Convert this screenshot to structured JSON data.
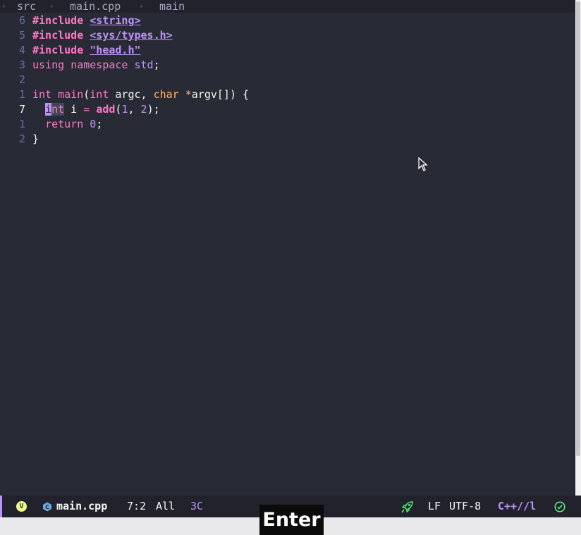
{
  "breadcrumb": {
    "sep": "›",
    "items": [
      "src",
      "main.cpp",
      "main"
    ]
  },
  "lines": [
    {
      "ln": "6",
      "parts": [
        {
          "t": "#include",
          "c": "kw-b"
        },
        {
          "t": " ",
          "c": ""
        },
        {
          "t": "<string>",
          "c": "inc"
        }
      ]
    },
    {
      "ln": "5",
      "parts": [
        {
          "t": "#include",
          "c": "kw-b"
        },
        {
          "t": " ",
          "c": ""
        },
        {
          "t": "<sys/types.h>",
          "c": "inc"
        }
      ]
    },
    {
      "ln": "4",
      "parts": [
        {
          "t": "#include",
          "c": "kw-b"
        },
        {
          "t": " ",
          "c": ""
        },
        {
          "t": "\"head.h\"",
          "c": "inc"
        }
      ]
    },
    {
      "ln": "3",
      "parts": [
        {
          "t": "using",
          "c": "kw"
        },
        {
          "t": " ",
          "c": ""
        },
        {
          "t": "namespace",
          "c": "kw"
        },
        {
          "t": " ",
          "c": ""
        },
        {
          "t": "std",
          "c": "std"
        },
        {
          "t": ";",
          "c": ""
        }
      ]
    },
    {
      "ln": "2",
      "parts": []
    },
    {
      "ln": "1",
      "parts": [
        {
          "t": "int",
          "c": "kw"
        },
        {
          "t": " ",
          "c": ""
        },
        {
          "t": "main",
          "c": "kw"
        },
        {
          "t": "(",
          "c": ""
        },
        {
          "t": "int",
          "c": "kw"
        },
        {
          "t": " argc, ",
          "c": ""
        },
        {
          "t": "char",
          "c": "char"
        },
        {
          "t": " ",
          "c": ""
        },
        {
          "t": "*",
          "c": "ptr"
        },
        {
          "t": "argv[]) {",
          "c": ""
        }
      ]
    },
    {
      "ln": "7",
      "current": true,
      "parts": [
        {
          "t": "  ",
          "c": ""
        },
        {
          "t": "i",
          "c": "cursor"
        },
        {
          "t": "nt",
          "c": "int-hl"
        },
        {
          "t": " i ",
          "c": ""
        },
        {
          "t": "=",
          "c": "kw"
        },
        {
          "t": " ",
          "c": ""
        },
        {
          "t": "add",
          "c": "fn-b"
        },
        {
          "t": "(",
          "c": ""
        },
        {
          "t": "1",
          "c": "num"
        },
        {
          "t": ", ",
          "c": ""
        },
        {
          "t": "2",
          "c": "num"
        },
        {
          "t": ");",
          "c": ""
        }
      ]
    },
    {
      "ln": "1",
      "parts": [
        {
          "t": "  ",
          "c": ""
        },
        {
          "t": "return",
          "c": "kw"
        },
        {
          "t": " ",
          "c": ""
        },
        {
          "t": "0",
          "c": "num"
        },
        {
          "t": ";",
          "c": ""
        }
      ]
    },
    {
      "ln": "2",
      "parts": [
        {
          "t": "}",
          "c": ""
        }
      ]
    }
  ],
  "modeline": {
    "evil_state": "V",
    "filename": "main.cpp",
    "position": "7:2",
    "scope": "All",
    "column": "3C",
    "eol": "LF",
    "encoding": "UTF-8",
    "mode": "C++//l"
  },
  "key_overlay": "Enter",
  "icons": {
    "file_type": "cpp-icon",
    "rocket": "rocket-icon",
    "check": "check-circle-icon",
    "mouse": "mouse-pointer-icon"
  },
  "colors": {
    "background": "#282a36",
    "keyword": "#ff79c6",
    "accent": "#bd93f9",
    "green": "#50fa7b",
    "orange": "#ffb86c"
  }
}
